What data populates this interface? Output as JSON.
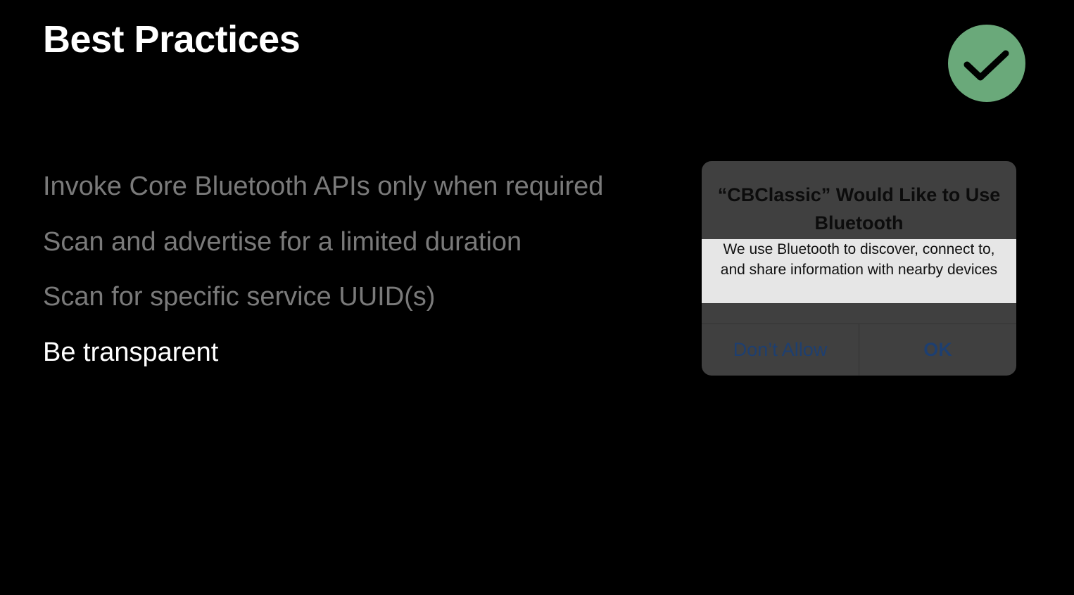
{
  "slide": {
    "title": "Best Practices",
    "badge_icon": "checkmark-icon",
    "badge_color": "#6aa97a"
  },
  "bullets": [
    {
      "text": "Invoke Core Bluetooth APIs only when required",
      "state": "dimmed"
    },
    {
      "text": "Scan and advertise for a limited duration",
      "state": "dimmed"
    },
    {
      "text": "Scan for specific service UUID(s)",
      "state": "dimmed"
    },
    {
      "text": "Be transparent",
      "state": "active"
    }
  ],
  "alert": {
    "title": "“CBClassic” Would Like to Use Bluetooth",
    "message": "We use Bluetooth to discover, connect to, and share information with nearby devices",
    "buttons": {
      "deny_label": "Don’t Allow",
      "ok_label": "OK"
    }
  }
}
